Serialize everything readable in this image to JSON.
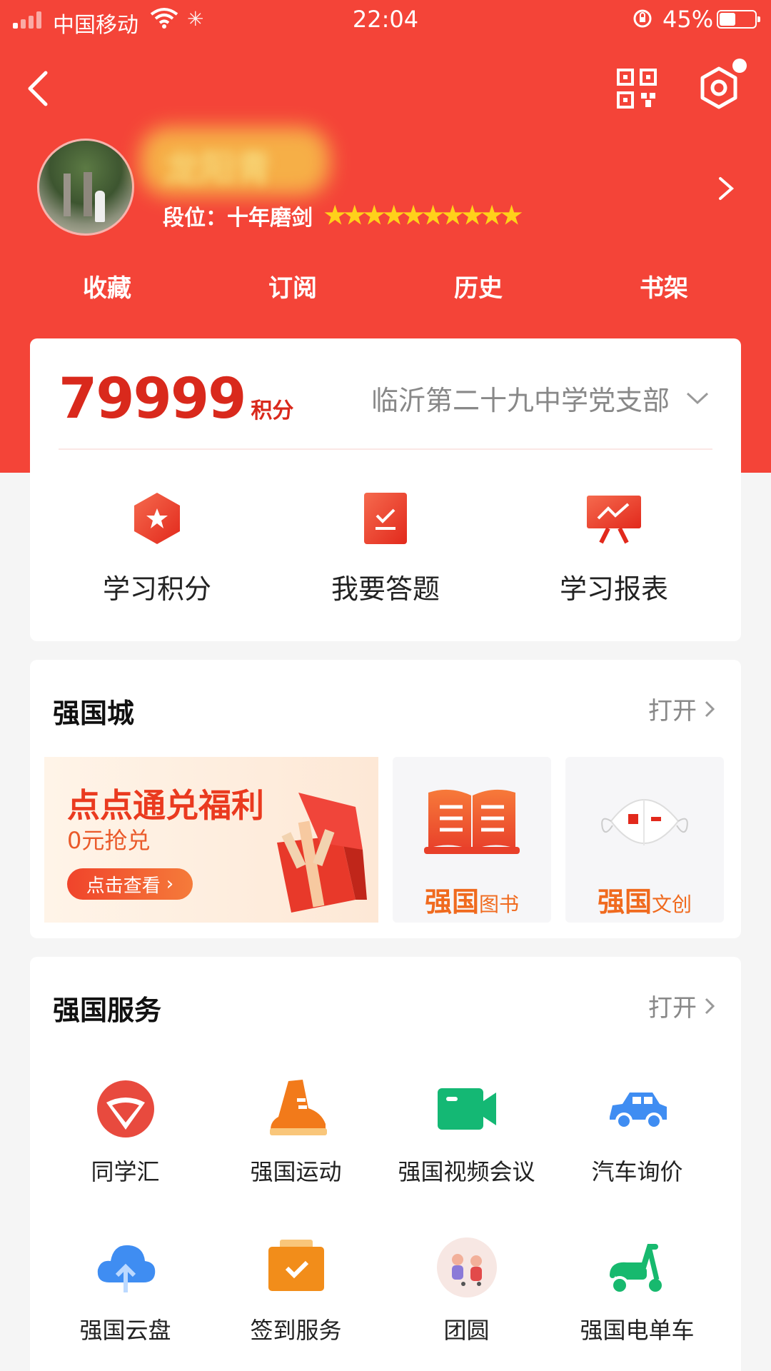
{
  "status_bar": {
    "carrier": "中国移动",
    "time": "22:04",
    "battery": "45%"
  },
  "profile": {
    "name": "龙阳青",
    "rank_label": "段位：",
    "rank_value": "十年磨剑",
    "stars": "★★★★★★★★★★"
  },
  "top_tabs": [
    "收藏",
    "订阅",
    "历史",
    "书架"
  ],
  "points_card": {
    "points": "79999",
    "points_unit": "积分",
    "branch": "临沂第二十九中学党支部",
    "quick_actions": [
      "学习积分",
      "我要答题",
      "学习报表"
    ]
  },
  "qiangguo_city": {
    "title": "强国城",
    "open_label": "打开",
    "banner_title": "点点通兑福利",
    "banner_sub": "0元抢兑",
    "banner_button": "点击查看",
    "tile1_main": "强国",
    "tile1_sub": "图书",
    "tile2_main": "强国",
    "tile2_sub": "文创"
  },
  "qiangguo_services": {
    "title": "强国服务",
    "open_label": "打开",
    "items": [
      "同学汇",
      "强国运动",
      "强国视频会议",
      "汽车询价",
      "强国云盘",
      "签到服务",
      "团圆",
      "强国电单车"
    ]
  },
  "colors": {
    "brand_red": "#f44438",
    "accent_orange": "#f06a1e",
    "star_yellow": "#ffd11a"
  }
}
